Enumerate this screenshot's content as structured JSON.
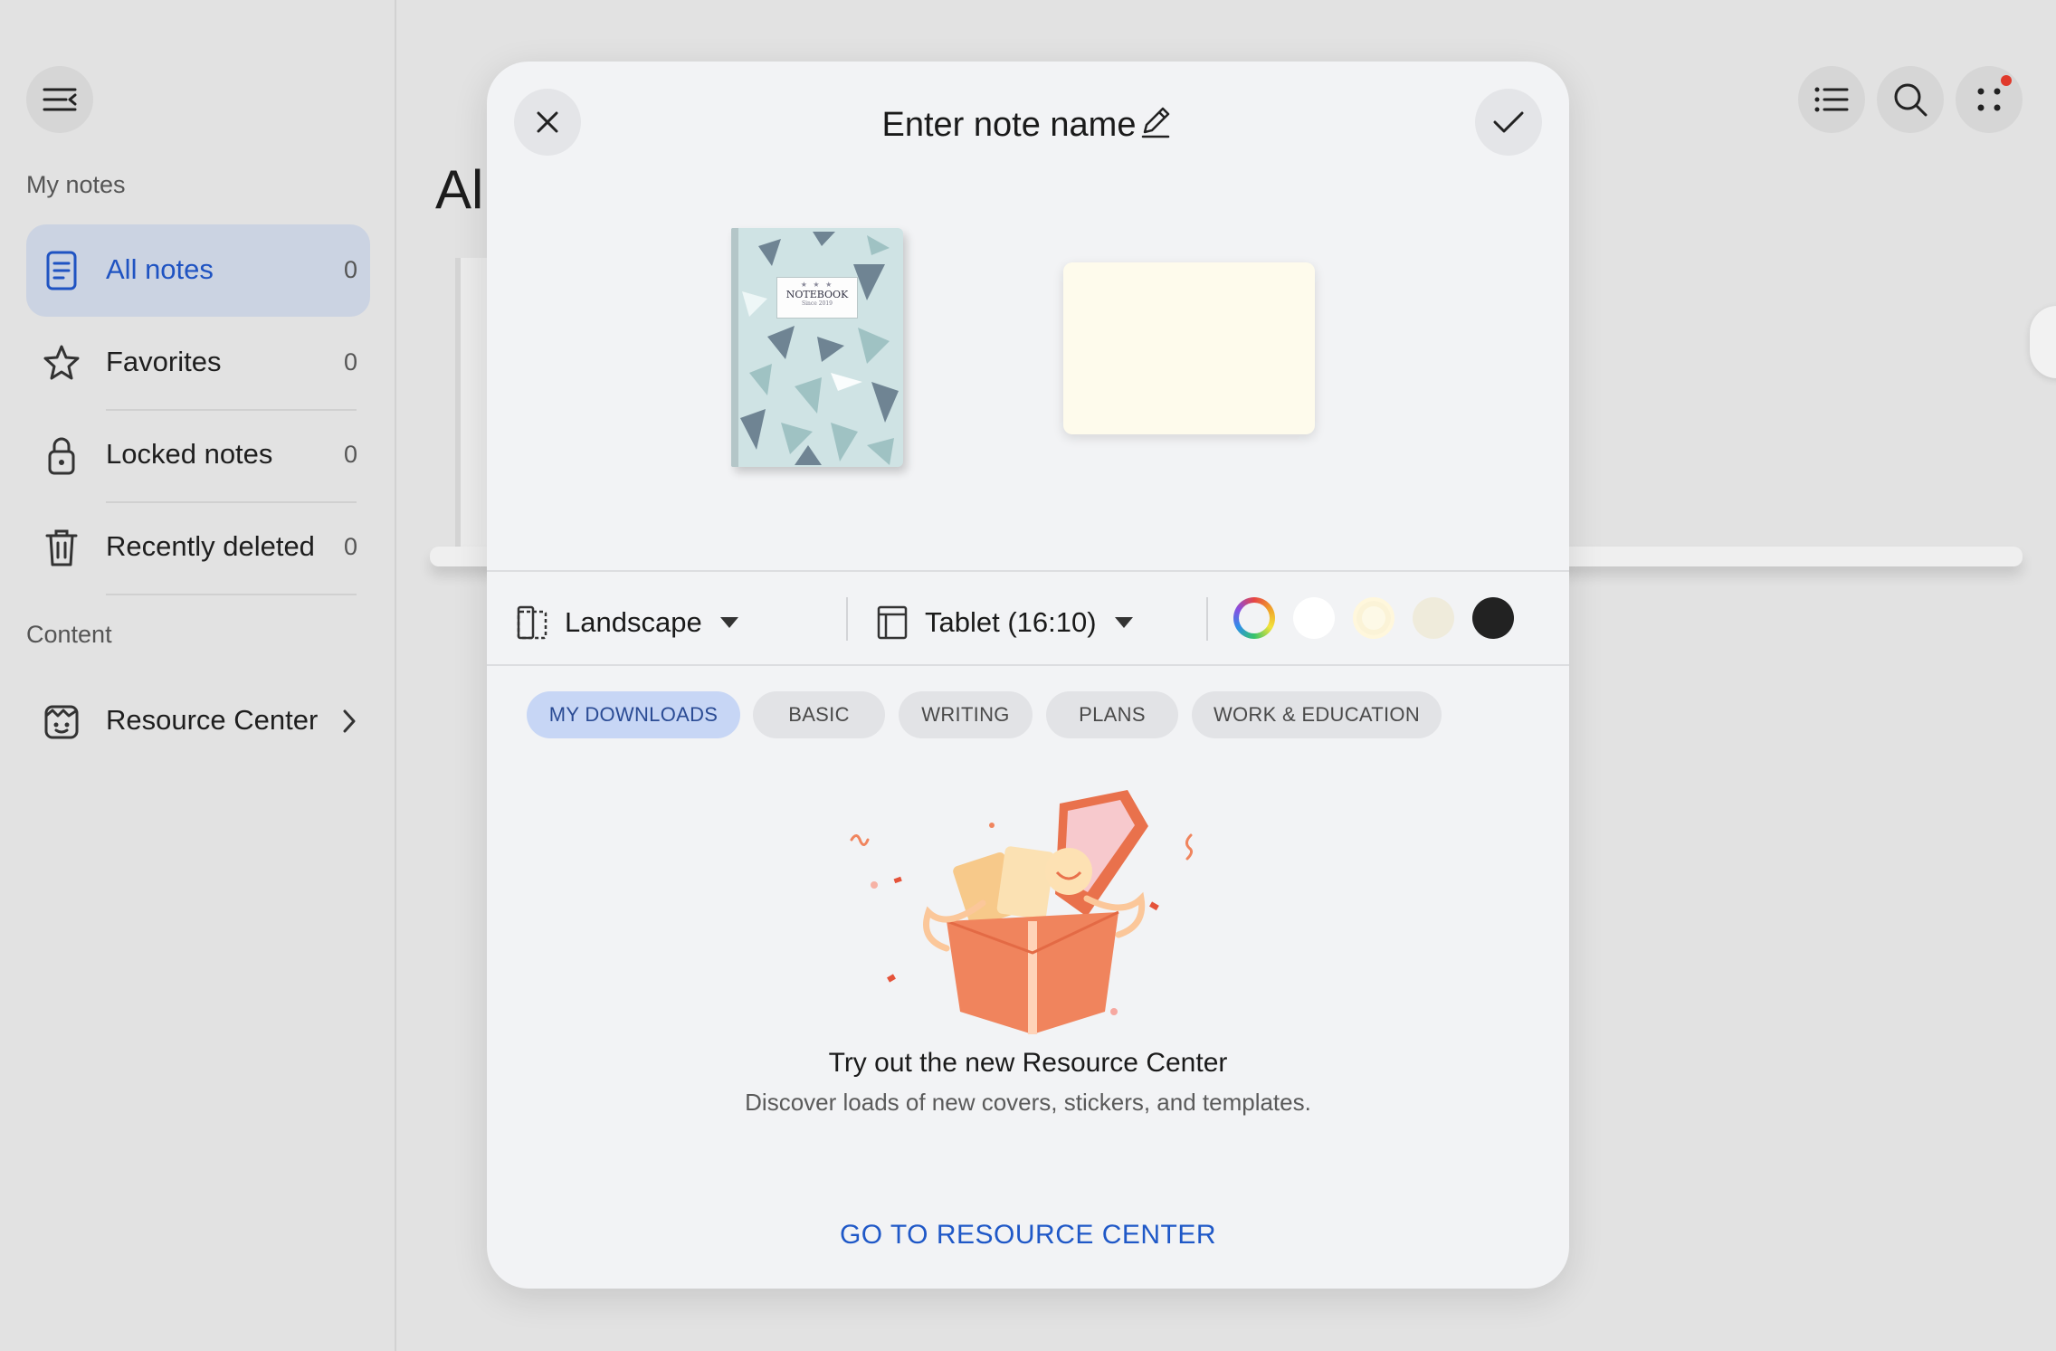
{
  "sidebar": {
    "my_notes_label": "My notes",
    "content_label": "Content",
    "items": [
      {
        "label": "All notes",
        "count": "0"
      },
      {
        "label": "Favorites",
        "count": "0"
      },
      {
        "label": "Locked notes",
        "count": "0"
      },
      {
        "label": "Recently deleted",
        "count": "0"
      }
    ],
    "resource_center": {
      "label": "Resource Center"
    }
  },
  "main": {
    "title_partial": "Al"
  },
  "dialog": {
    "title": "Enter note name",
    "cover": {
      "title": "NOTEBOOK",
      "stars": "★ ★ ★",
      "subtitle": "Since 2019"
    },
    "orientation": {
      "value": "Landscape"
    },
    "page_size": {
      "value": "Tablet (16:10)"
    },
    "paper_colors": [
      {
        "name": "custom-color",
        "hex": "multicolor"
      },
      {
        "name": "white",
        "hex": "#ffffff"
      },
      {
        "name": "cream",
        "hex": "#fdf9e7",
        "selected": true
      },
      {
        "name": "beige",
        "hex": "#efebdb"
      },
      {
        "name": "black",
        "hex": "#222222"
      }
    ],
    "tabs": [
      {
        "label": "MY DOWNLOADS",
        "active": true
      },
      {
        "label": "BASIC"
      },
      {
        "label": "WRITING"
      },
      {
        "label": "PLANS"
      },
      {
        "label": "WORK & EDUCATION"
      }
    ],
    "empty_state": {
      "title": "Try out the new Resource Center",
      "subtitle": "Discover loads of new covers, stickers, and templates.",
      "action": "GO TO RESOURCE CENTER"
    }
  },
  "colors": {
    "accent": "#1f58c7",
    "active_nav_bg": "#cbd3e2",
    "active_chip_bg": "#c7d6f5",
    "notification_dot": "#e0392b"
  }
}
